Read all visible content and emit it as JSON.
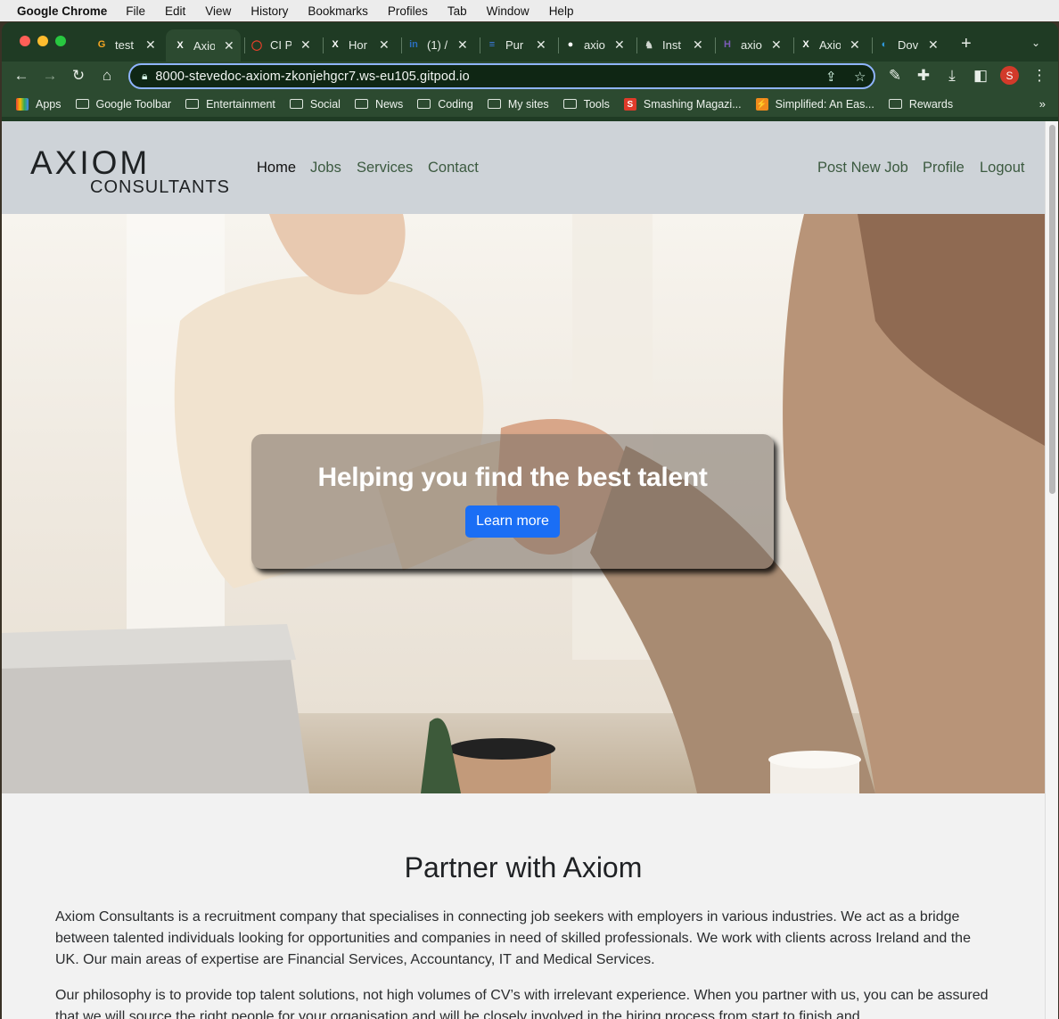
{
  "menubar": {
    "app": "Google Chrome",
    "items": [
      "File",
      "Edit",
      "View",
      "History",
      "Bookmarks",
      "Profiles",
      "Tab",
      "Window",
      "Help"
    ]
  },
  "tabs": [
    {
      "title": "test",
      "icon": "g-icon",
      "color": "#f5a623",
      "glyph": "G"
    },
    {
      "title": "Axio",
      "icon": "axiom-x-icon",
      "color": "#ffffff",
      "glyph": "X",
      "active": true
    },
    {
      "title": "CI P",
      "icon": "ci-ring-icon",
      "color": "#e8402a",
      "glyph": "◯"
    },
    {
      "title": "Hor",
      "icon": "axiom-x-icon",
      "color": "#ffffff",
      "glyph": "X"
    },
    {
      "title": "(1) /",
      "icon": "linkedin-icon",
      "color": "#2b6fc0",
      "glyph": "in"
    },
    {
      "title": "Pur",
      "icon": "docs-icon",
      "color": "#3d7fea",
      "glyph": "≡"
    },
    {
      "title": "axio",
      "icon": "github-icon",
      "color": "#ffffff",
      "glyph": "●"
    },
    {
      "title": "Inst",
      "icon": "elephant-icon",
      "color": "#cfd6cf",
      "glyph": "♞"
    },
    {
      "title": "axio",
      "icon": "heroku-icon",
      "color": "#7b5bb6",
      "glyph": "H"
    },
    {
      "title": "Axio",
      "icon": "axiom-x-icon",
      "color": "#ffffff",
      "glyph": "X"
    },
    {
      "title": "Dov",
      "icon": "edge-icon",
      "color": "#2f9be0",
      "glyph": "◐"
    }
  ],
  "omnibox": {
    "url": "8000-stevedoc-axiom-zkonjehgcr7.ws-eu105.gitpod.io"
  },
  "profile_initial": "S",
  "bookmarks": [
    {
      "label": "Apps",
      "type": "apps"
    },
    {
      "label": "Google Toolbar",
      "type": "folder"
    },
    {
      "label": "Entertainment",
      "type": "folder"
    },
    {
      "label": "Social",
      "type": "folder"
    },
    {
      "label": "News",
      "type": "folder"
    },
    {
      "label": "Coding",
      "type": "folder"
    },
    {
      "label": "My sites",
      "type": "folder"
    },
    {
      "label": "Tools",
      "type": "folder"
    },
    {
      "label": "Smashing Magazi...",
      "type": "site",
      "color": "#e03b2a",
      "glyph": "S"
    },
    {
      "label": "Simplified: An Eas...",
      "type": "site",
      "color": "#f08a1c",
      "glyph": "⚡"
    },
    {
      "label": "Rewards",
      "type": "folder"
    }
  ],
  "site": {
    "logo_line1": "AXIOM",
    "logo_line2": "CONSULTANTS",
    "nav_left": [
      "Home",
      "Jobs",
      "Services",
      "Contact"
    ],
    "nav_right": [
      "Post New Job",
      "Profile",
      "Logout"
    ],
    "hero_title": "Helping you find the best talent",
    "hero_button": "Learn more",
    "section_title": "Partner with Axiom",
    "para1": "Axiom Consultants is a recruitment company that specialises in connecting job seekers with employers in various industries. We act as a bridge between talented individuals looking for opportunities and companies in need of skilled professionals. We work with clients across Ireland and the UK. Our main areas of expertise are Financial Services, Accountancy, IT and Medical Services.",
    "para2": "Our philosophy is to provide top talent solutions, not high volumes of CV’s with irrelevant experience. When you partner with us, you can be assured that we will source the right people for your organisation and will be closely involved in the hiring process from start to finish and"
  },
  "colors": {
    "accent": "#1a6ef5",
    "chrome_frame": "#1f3b24",
    "nav_bg": "#ced3d8"
  }
}
